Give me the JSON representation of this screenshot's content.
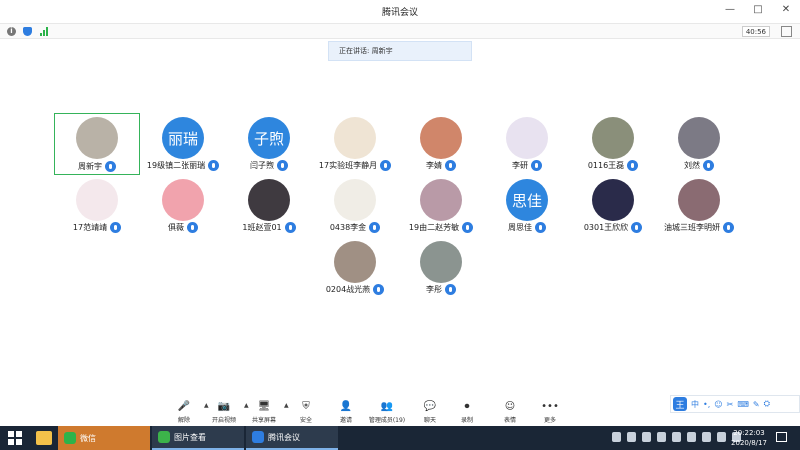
{
  "window": {
    "title": "腾讯会议",
    "controls": [
      "—",
      "□",
      "✕"
    ]
  },
  "infobar": {
    "timer": "40:56"
  },
  "speaker": {
    "text": "正在讲话: 周新宇"
  },
  "participants": [
    {
      "name": "周新宇",
      "avatar_text": "",
      "color": "#b9b2a7",
      "active": true
    },
    {
      "name": "19级镇二张丽瑞",
      "avatar_text": "丽瑞",
      "color": "#2e86de",
      "active": false
    },
    {
      "name": "闫子煦",
      "avatar_text": "子煦",
      "color": "#2e86de",
      "active": false
    },
    {
      "name": "17实验班李静月",
      "avatar_text": "",
      "color": "#efe4d4",
      "active": false
    },
    {
      "name": "李婧",
      "avatar_text": "",
      "color": "#d0866a",
      "active": false
    },
    {
      "name": "李研",
      "avatar_text": "",
      "color": "#e8e2f0",
      "active": false
    },
    {
      "name": "0116王磊",
      "avatar_text": "",
      "color": "#8a8f7a",
      "active": false
    },
    {
      "name": "刘然",
      "avatar_text": "",
      "color": "#7c7a85",
      "active": false
    },
    {
      "name": "17范靖靖",
      "avatar_text": "",
      "color": "#f4e8ec",
      "active": false
    },
    {
      "name": "俱薇",
      "avatar_text": "",
      "color": "#f1a3ad",
      "active": false
    },
    {
      "name": "1班赵萱01",
      "avatar_text": "",
      "color": "#3f3a40",
      "active": false
    },
    {
      "name": "0438李金",
      "avatar_text": "",
      "color": "#f0ede6",
      "active": false
    },
    {
      "name": "19由二赵芳敏",
      "avatar_text": "",
      "color": "#b99aa7",
      "active": false
    },
    {
      "name": "周思佳",
      "avatar_text": "思佳",
      "color": "#2e86de",
      "active": false
    },
    {
      "name": "0301王欣欣",
      "avatar_text": "",
      "color": "#2a2b4a",
      "active": false
    },
    {
      "name": "油城三班李明妍",
      "avatar_text": "",
      "color": "#8a6b72",
      "active": false
    },
    {
      "name": "0204战光燕",
      "avatar_text": "",
      "color": "#a09084",
      "active": false
    },
    {
      "name": "李彤",
      "avatar_text": "",
      "color": "#8b9490",
      "active": false
    }
  ],
  "toolbar": [
    {
      "label": "解除",
      "icon": "microphone-icon",
      "glyph": "🎤"
    },
    {
      "label": "开启视频",
      "icon": "camera-off-icon",
      "glyph": "📷"
    },
    {
      "label": "共享屏幕",
      "icon": "share-screen-icon",
      "glyph": "🖥"
    },
    {
      "label": "安全",
      "icon": "shield-icon",
      "glyph": "⛨"
    },
    {
      "label": "邀请",
      "icon": "invite-icon",
      "glyph": "👤"
    },
    {
      "label": "管理成员(19)",
      "icon": "members-icon",
      "glyph": "👥"
    },
    {
      "label": "聊天",
      "icon": "chat-icon",
      "glyph": "💬"
    },
    {
      "label": "录制",
      "icon": "record-icon",
      "glyph": "⏺"
    },
    {
      "label": "表情",
      "icon": "emoji-icon",
      "glyph": "☺"
    },
    {
      "label": "更多",
      "icon": "more-icon",
      "glyph": "•••"
    }
  ],
  "ime": {
    "logo": "王",
    "mode": "中",
    "items": [
      "•,",
      "☺",
      "✂",
      "⌨",
      "✎",
      "⛭"
    ]
  },
  "taskbar": {
    "tasks": [
      {
        "label": "微信",
        "color": "#2cb34a"
      },
      {
        "label": "图片查看",
        "color": "#3cb34a"
      },
      {
        "label": "腾讯会议",
        "color": "#2e7de0"
      }
    ],
    "clock_time": "20:22:03",
    "clock_date": "2020/8/17"
  }
}
